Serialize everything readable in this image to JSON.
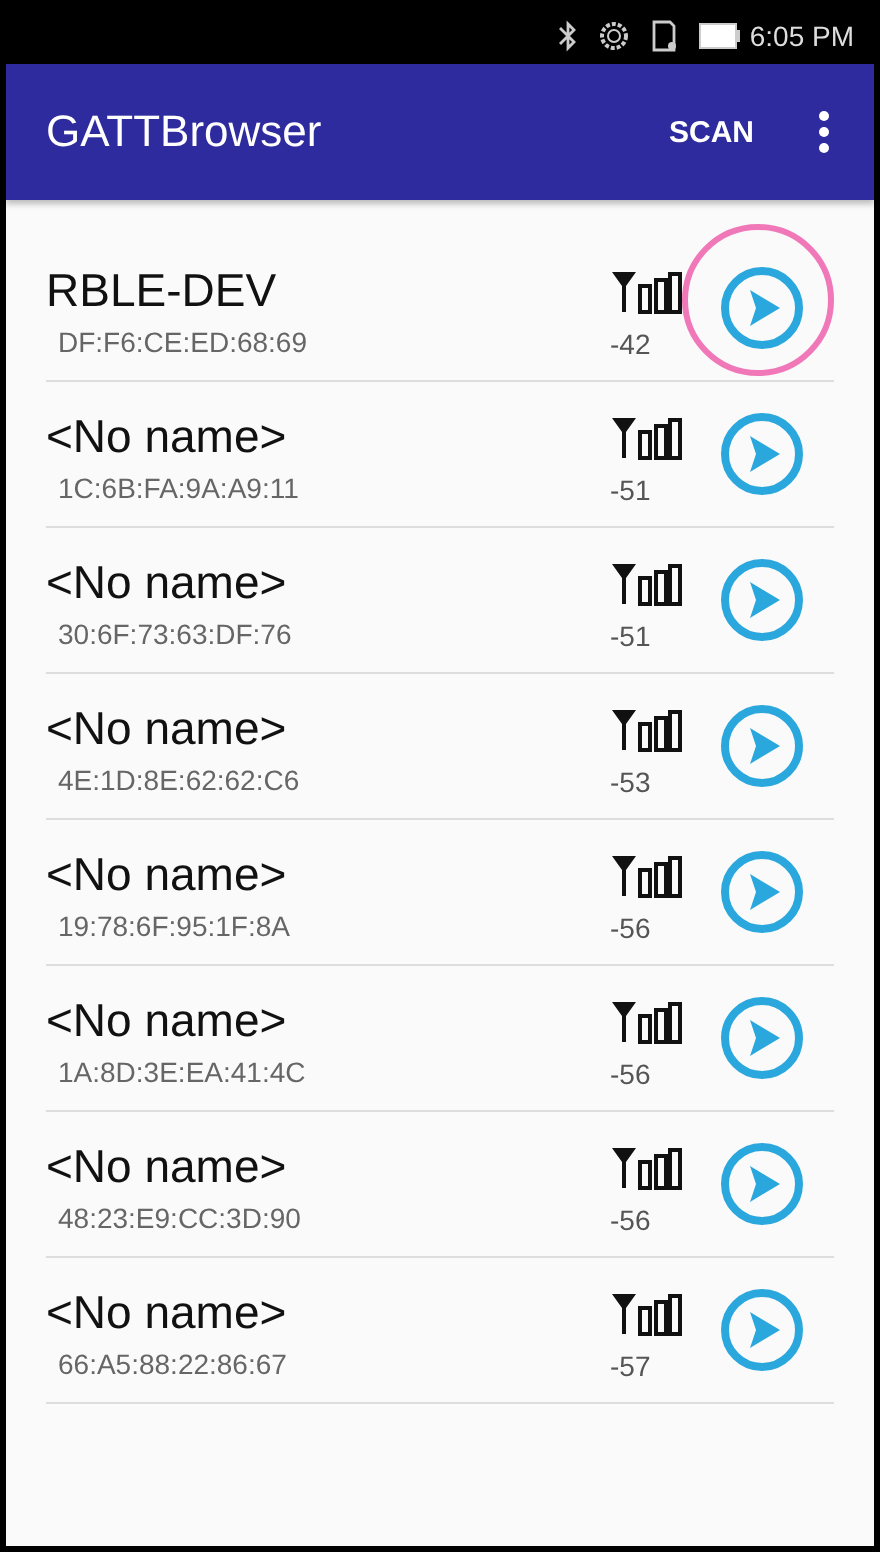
{
  "status_bar": {
    "time": "6:05 PM"
  },
  "app_bar": {
    "title": "GATTBrowser",
    "action": "SCAN"
  },
  "devices": [
    {
      "name": "RBLE-DEV",
      "address": "DF:F6:CE:ED:68:69",
      "rssi": "-42",
      "highlighted": true
    },
    {
      "name": "<No name>",
      "address": "1C:6B:FA:9A:A9:11",
      "rssi": "-51",
      "highlighted": false
    },
    {
      "name": "<No name>",
      "address": "30:6F:73:63:DF:76",
      "rssi": "-51",
      "highlighted": false
    },
    {
      "name": "<No name>",
      "address": "4E:1D:8E:62:62:C6",
      "rssi": "-53",
      "highlighted": false
    },
    {
      "name": "<No name>",
      "address": "19:78:6F:95:1F:8A",
      "rssi": "-56",
      "highlighted": false
    },
    {
      "name": "<No name>",
      "address": "1A:8D:3E:EA:41:4C",
      "rssi": "-56",
      "highlighted": false
    },
    {
      "name": "<No name>",
      "address": "48:23:E9:CC:3D:90",
      "rssi": "-56",
      "highlighted": false
    },
    {
      "name": "<No name>",
      "address": "66:A5:88:22:86:67",
      "rssi": "-57",
      "highlighted": false
    }
  ]
}
